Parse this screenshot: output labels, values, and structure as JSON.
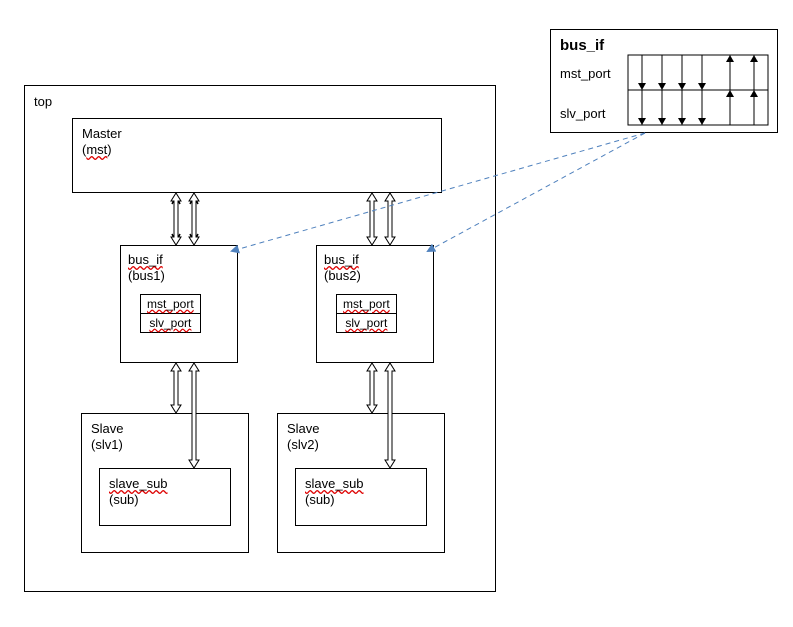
{
  "top": {
    "label": "top"
  },
  "master": {
    "title": "Master",
    "instance": "(mst)"
  },
  "bus1": {
    "title": "bus_if",
    "instance": "(bus1)",
    "mst_port": "mst_port",
    "slv_port": "slv_port"
  },
  "bus2": {
    "title": "bus_if",
    "instance": "(bus2)",
    "mst_port": "mst_port",
    "slv_port": "slv_port"
  },
  "slave1": {
    "title": "Slave",
    "instance": "(slv1)",
    "sub_title": "slave_sub",
    "sub_instance": "(sub)"
  },
  "slave2": {
    "title": "Slave",
    "instance": "(slv2)",
    "sub_title": "slave_sub",
    "sub_instance": "(sub)"
  },
  "detail": {
    "title": "bus_if",
    "mst_port": "mst_port",
    "slv_port": "slv_port"
  }
}
